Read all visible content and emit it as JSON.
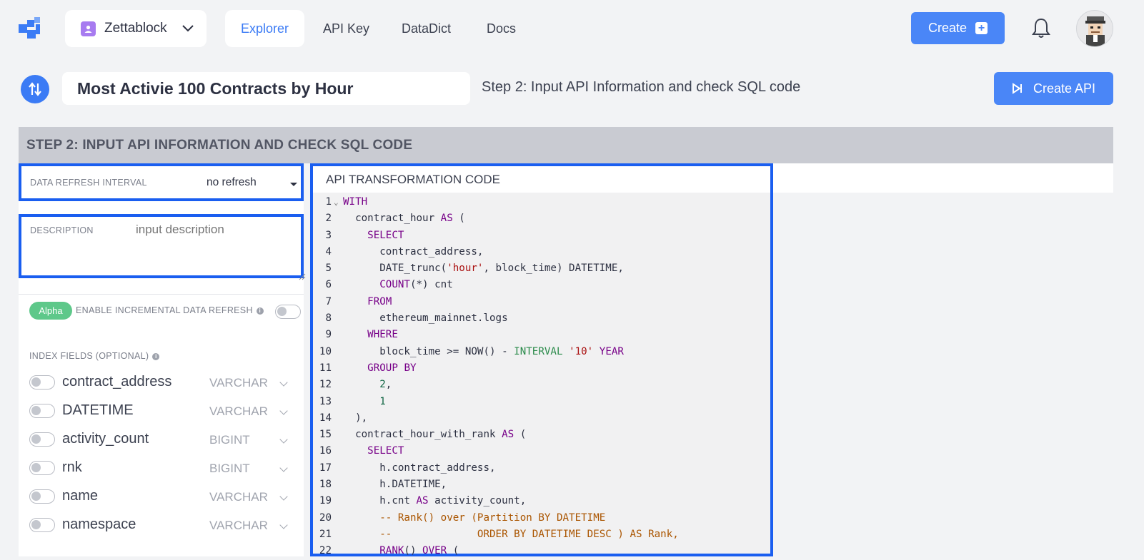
{
  "nav": {
    "org_name": "Zettablock",
    "items": [
      {
        "label": "Explorer",
        "active": true
      },
      {
        "label": "API Key",
        "active": false
      },
      {
        "label": "DataDict",
        "active": false
      },
      {
        "label": "Docs",
        "active": false
      }
    ],
    "create_label": "Create"
  },
  "header": {
    "query_title": "Most Activie 100 Contracts by Hour",
    "step_text": "Step 2: Input API Information and check SQL code",
    "create_api_label": "Create API"
  },
  "section": {
    "title": "STEP 2: INPUT API INFORMATION AND CHECK SQL CODE"
  },
  "form": {
    "refresh_label": "DATA REFRESH INTERVAL",
    "refresh_value": "no refresh",
    "description_label": "DESCRIPTION",
    "description_placeholder": "input description",
    "alpha_badge": "Alpha",
    "incremental_label": "ENABLE INCREMENTAL DATA REFRESH",
    "index_label": "INDEX FIELDS (OPTIONAL)",
    "index_fields": [
      {
        "name": "contract_address",
        "type": "VARCHAR"
      },
      {
        "name": "DATETIME",
        "type": "VARCHAR"
      },
      {
        "name": "activity_count",
        "type": "BIGINT"
      },
      {
        "name": "rnk",
        "type": "BIGINT"
      },
      {
        "name": "name",
        "type": "VARCHAR"
      },
      {
        "name": "namespace",
        "type": "VARCHAR"
      }
    ]
  },
  "code": {
    "title": "API TRANSFORMATION CODE",
    "lines": [
      "WITH",
      "  contract_hour AS (",
      "    SELECT",
      "      contract_address,",
      "      DATE_trunc('hour', block_time) DATETIME,",
      "      COUNT(*) cnt",
      "    FROM",
      "      ethereum_mainnet.logs",
      "    WHERE",
      "      block_time >= NOW() - INTERVAL '10' YEAR",
      "    GROUP BY",
      "      2,",
      "      1",
      "  ),",
      "  contract_hour_with_rank AS (",
      "    SELECT",
      "      h.contract_address,",
      "      h.DATETIME,",
      "      h.cnt AS activity_count,",
      "      -- Rank() over (Partition BY DATETIME",
      "      --              ORDER BY DATETIME DESC ) AS Rank,",
      "      RANK() OVER ("
    ]
  },
  "colors": {
    "accent": "#4a86f7",
    "focus_border": "#1a5ef0",
    "alpha_green": "#5ec88a"
  }
}
